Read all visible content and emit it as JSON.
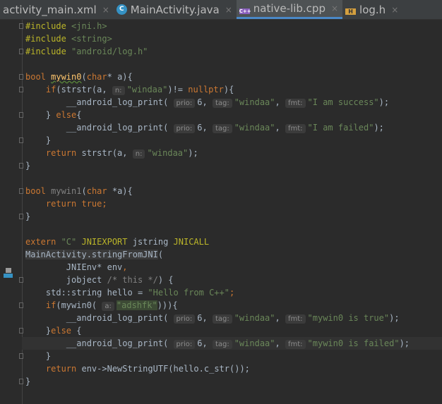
{
  "tabs": [
    {
      "label": "activity_main.xml",
      "icon": "none",
      "active": false
    },
    {
      "label": "MainActivity.java",
      "icon": "C",
      "active": false
    },
    {
      "label": "native-lib.cpp",
      "icon": "C++",
      "active": true
    },
    {
      "label": "log.h",
      "icon": "H",
      "active": false
    }
  ],
  "close_glyph": "×",
  "code": [
    [
      [
        "mac",
        "#include "
      ],
      [
        "str",
        "<jni.h>"
      ]
    ],
    [
      [
        "mac",
        "#include "
      ],
      [
        "str",
        "<string>"
      ]
    ],
    [
      [
        "mac",
        "#include "
      ],
      [
        "str",
        "\"android/log.h\""
      ]
    ],
    [],
    [
      [
        "kw",
        "bool "
      ],
      [
        "fn wavy",
        "mywin0"
      ],
      [
        "t",
        "("
      ],
      [
        "kw",
        "char"
      ],
      [
        "t",
        "* a){"
      ]
    ],
    [
      [
        "t",
        "    "
      ],
      [
        "kw",
        "if"
      ],
      [
        "t",
        "(strstr(a, "
      ],
      [
        "hint",
        "n:"
      ],
      [
        "str",
        "\"windaa\""
      ],
      [
        "t",
        ")!= "
      ],
      [
        "kw",
        "nullptr"
      ],
      [
        "t",
        "){"
      ]
    ],
    [
      [
        "t",
        "        __android_log_print( "
      ],
      [
        "hint",
        "prio:"
      ],
      [
        "t",
        "6, "
      ],
      [
        "hint",
        "tag:"
      ],
      [
        "str",
        "\"windaa\""
      ],
      [
        "t",
        ", "
      ],
      [
        "hint",
        "fmt:"
      ],
      [
        "str",
        "\"I am success\""
      ],
      [
        "t",
        ");"
      ]
    ],
    [
      [
        "t",
        "    } "
      ],
      [
        "kw",
        "else"
      ],
      [
        "t",
        "{"
      ]
    ],
    [
      [
        "t",
        "        __android_log_print( "
      ],
      [
        "hint",
        "prio:"
      ],
      [
        "t",
        "6, "
      ],
      [
        "hint",
        "tag:"
      ],
      [
        "str",
        "\"windaa\""
      ],
      [
        "t",
        ", "
      ],
      [
        "hint",
        "fmt:"
      ],
      [
        "str",
        "\"I am failed\""
      ],
      [
        "t",
        ");"
      ]
    ],
    [
      [
        "t",
        "    }"
      ]
    ],
    [
      [
        "t",
        "    "
      ],
      [
        "kw",
        "return "
      ],
      [
        "t",
        "strstr(a, "
      ],
      [
        "hint",
        "n:"
      ],
      [
        "str",
        "\"windaa\""
      ],
      [
        "t",
        ");"
      ]
    ],
    [
      [
        "t",
        "}"
      ]
    ],
    [],
    [
      [
        "kw",
        "bool "
      ],
      [
        "un",
        "mywin1"
      ],
      [
        "t",
        "("
      ],
      [
        "kw",
        "char "
      ],
      [
        "t",
        "*a){"
      ]
    ],
    [
      [
        "t",
        "    "
      ],
      [
        "kw",
        "return true;"
      ]
    ],
    [
      [
        "t",
        "}"
      ]
    ],
    [],
    [
      [
        "kw",
        "extern "
      ],
      [
        "str",
        "\"C\" "
      ],
      [
        "mac",
        "JNIEXPORT "
      ],
      [
        "t",
        "jstring "
      ],
      [
        "mac",
        "JNICALL"
      ]
    ],
    [
      [
        "sel",
        "MainActivity.stringFromJNI"
      ],
      [
        "t",
        "("
      ]
    ],
    [
      [
        "t",
        "        JNIEnv* env"
      ],
      [
        "kw",
        ","
      ]
    ],
    [
      [
        "t",
        "        jobject "
      ],
      [
        "cm",
        "/* this */"
      ],
      [
        "t",
        ") {"
      ]
    ],
    [
      [
        "t",
        "    std::string hello = "
      ],
      [
        "str",
        "\"Hello from C++\""
      ],
      [
        "kw",
        ";"
      ]
    ],
    [
      [
        "t",
        "    "
      ],
      [
        "kw",
        "if"
      ],
      [
        "t",
        "(mywin0( "
      ],
      [
        "hint",
        "a:"
      ],
      [
        "str hl",
        "\"adshfk\""
      ],
      [
        "t",
        "))){"
      ]
    ],
    [
      [
        "t",
        "        __android_log_print( "
      ],
      [
        "hint",
        "prio:"
      ],
      [
        "t",
        "6, "
      ],
      [
        "hint",
        "tag:"
      ],
      [
        "str",
        "\"windaa\""
      ],
      [
        "t",
        ", "
      ],
      [
        "hint",
        "fmt:"
      ],
      [
        "str",
        "\"mywin0 is true\""
      ],
      [
        "t",
        ");"
      ]
    ],
    [
      [
        "t",
        "    }"
      ],
      [
        "kw",
        "else "
      ],
      [
        "t",
        "{"
      ]
    ],
    [
      [
        "t",
        "        __android_log_print( "
      ],
      [
        "hint",
        "prio:"
      ],
      [
        "t",
        "6, "
      ],
      [
        "hint",
        "tag:"
      ],
      [
        "str",
        "\"windaa\""
      ],
      [
        "t",
        ", "
      ],
      [
        "hint",
        "fmt:"
      ],
      [
        "str",
        "\"mywin0 is failed\""
      ],
      [
        "t",
        ");"
      ]
    ],
    [
      [
        "t",
        "    }"
      ]
    ],
    [
      [
        "t",
        "    "
      ],
      [
        "kw",
        "return "
      ],
      [
        "t",
        "env->NewStringUTF(hello.c_str());"
      ]
    ],
    [
      [
        "t",
        "}"
      ]
    ]
  ],
  "current_line": 26
}
